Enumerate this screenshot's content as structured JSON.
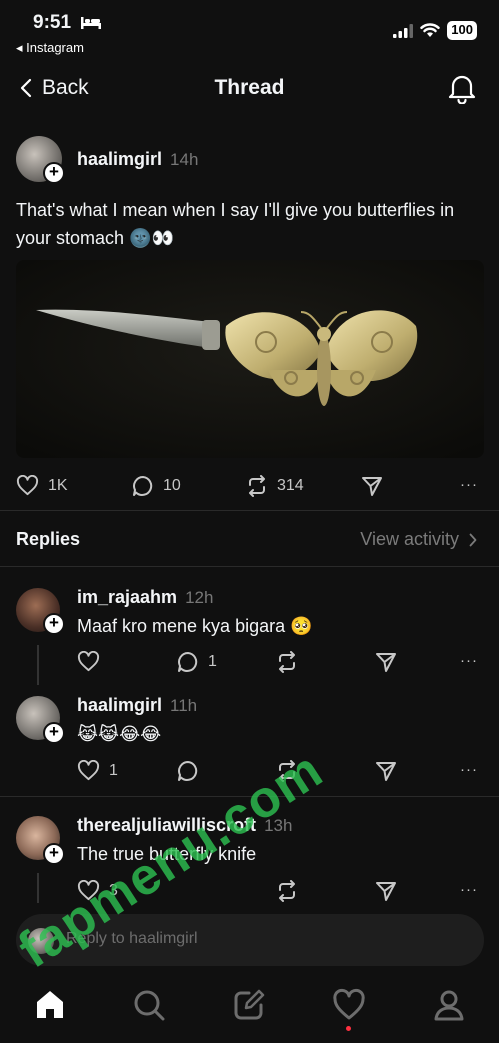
{
  "status_bar": {
    "time": "9:51",
    "back_app": "◂ Instagram",
    "battery": "100"
  },
  "nav": {
    "back_label": "Back",
    "title": "Thread"
  },
  "post": {
    "username": "haalimgirl",
    "time": "14h",
    "text": "That's what I mean when I say I'll give you butterflies in your stomach 🌚👀",
    "likes": "1K",
    "comments": "10",
    "reposts": "314"
  },
  "replies_section": {
    "label": "Replies",
    "view_activity": "View activity"
  },
  "replies": [
    {
      "username": "im_rajaahm",
      "time": "12h",
      "text": "Maaf kro mene kya bigara 🥺",
      "likes": "",
      "comments": "1"
    },
    {
      "username": "haalimgirl",
      "time": "11h",
      "text": "😹😹😂😂",
      "likes": "1",
      "comments": ""
    },
    {
      "username": "therealjuliawilliscroft",
      "time": "13h",
      "text": "The true butterfly knife",
      "likes": "3",
      "comments": ""
    }
  ],
  "compose": {
    "placeholder": "Reply to haalimgirl"
  },
  "watermark": "fapmenu.com",
  "colors": {
    "background": "#101010",
    "text": "#f3f5f7",
    "muted": "#777777",
    "notification_dot": "#ff3040",
    "watermark": "#2dbe50"
  }
}
